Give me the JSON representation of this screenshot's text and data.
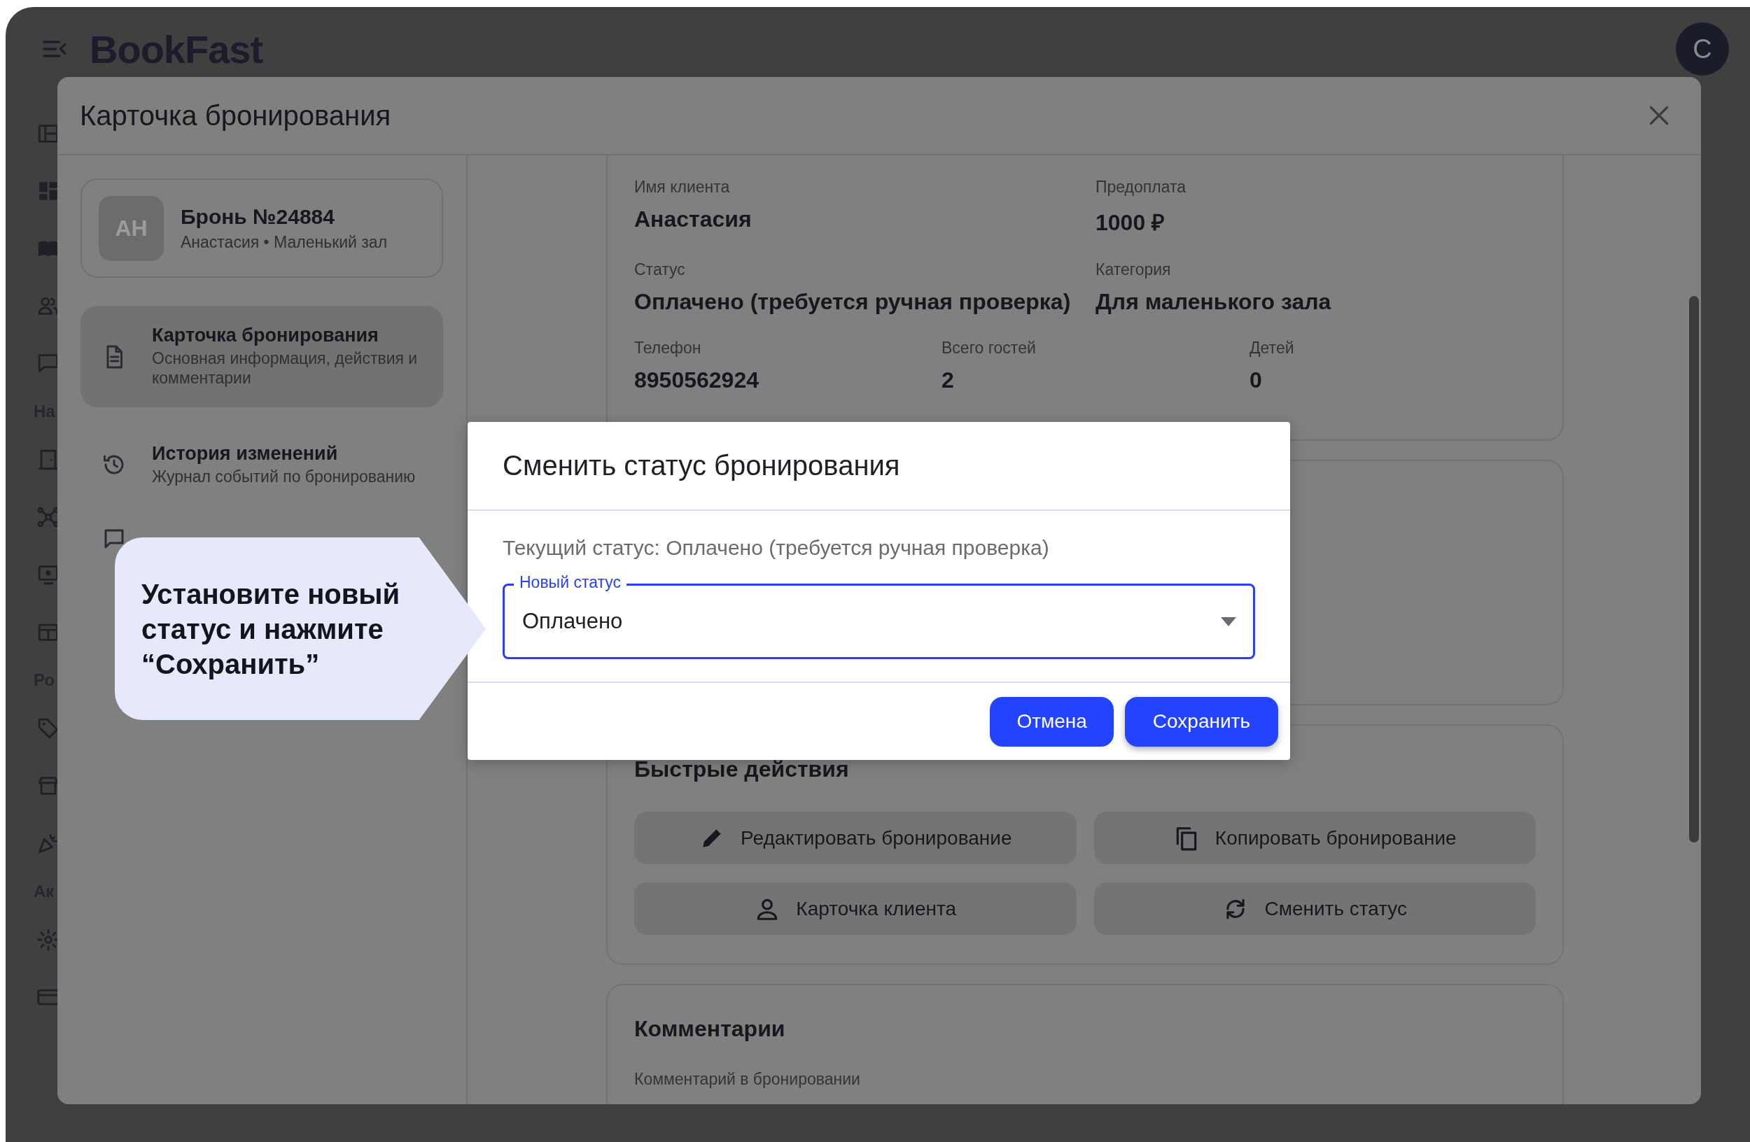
{
  "app": {
    "logo": "BookFast",
    "avatar": "C"
  },
  "sidebar": {
    "headings": [
      "На",
      "Ро",
      "Ак"
    ]
  },
  "sheet": {
    "title": "Карточка бронирования",
    "booking": {
      "initials": "АН",
      "title": "Бронь №24884",
      "subtitle": "Анастасия • Маленький зал"
    },
    "nav": [
      {
        "title": "Карточка бронирования",
        "subtitle": "Основная информация, действия и комментарии",
        "selected": true
      },
      {
        "title": "История изменений",
        "subtitle": "Журнал событий по бронированию",
        "selected": false
      }
    ],
    "details": {
      "rows": [
        [
          {
            "label": "Имя клиента",
            "value": "Анастасия"
          },
          {
            "label": "Предоплата",
            "value": "1000 ₽"
          }
        ],
        [
          {
            "label": "Статус",
            "value": "Оплачено (требуется ручная проверка)"
          },
          {
            "label": "Категория",
            "value": "Для маленького зала"
          }
        ],
        [
          {
            "label": "Телефон",
            "value": "8950562924"
          },
          {
            "label": "Всего гостей",
            "value": "2"
          },
          {
            "label": "Детей",
            "value": "0"
          }
        ]
      ]
    },
    "quick_actions": {
      "title": "Быстрые действия",
      "buttons": [
        "Редактировать бронирование",
        "Копировать бронирование",
        "Карточка клиента",
        "Сменить статус"
      ]
    },
    "comments": {
      "title": "Комментарии",
      "field_label": "Комментарий в бронировании"
    }
  },
  "dialog": {
    "title": "Сменить статус бронирования",
    "current_status": "Текущий статус: Оплачено (требуется ручная проверка)",
    "select": {
      "label": "Новый статус",
      "value": "Оплачено"
    },
    "buttons": [
      "Отмена",
      "Сохранить"
    ]
  },
  "callout": {
    "text": "Установите новый статус и нажмите “Сохранить”"
  }
}
